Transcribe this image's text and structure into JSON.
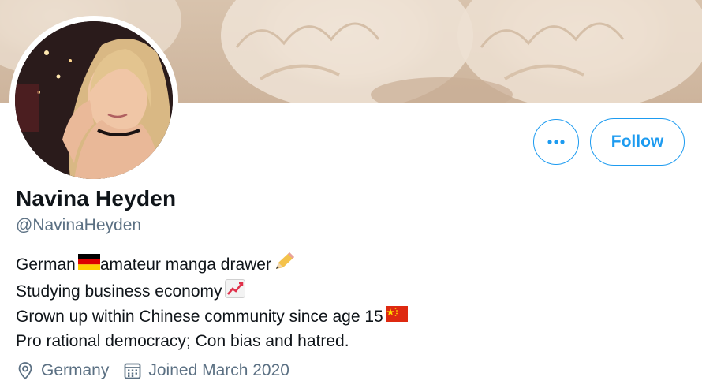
{
  "profile": {
    "display_name": "Navina Heyden",
    "handle": "@NavinaHeyden"
  },
  "actions": {
    "more_label": "•••",
    "follow_label": "Follow"
  },
  "bio": {
    "line1_a": "German",
    "line1_b": " amateur manga drawer",
    "line2": "Studying business economy",
    "line3": "Grown up within Chinese community since age 15",
    "line4": "Pro rational democracy; Con bias and hatred."
  },
  "meta": {
    "location": "Germany",
    "joined": "Joined March 2020"
  },
  "icons": {
    "location": "location-pin-icon",
    "joined": "calendar-icon",
    "flag_germany": "flag-germany-icon",
    "pencil": "pencil-icon",
    "chart": "chart-increasing-icon",
    "flag_china": "flag-china-icon"
  },
  "colors": {
    "accent": "#1d9bf0",
    "secondary_text": "#5b7083",
    "primary_text": "#0f1419"
  }
}
